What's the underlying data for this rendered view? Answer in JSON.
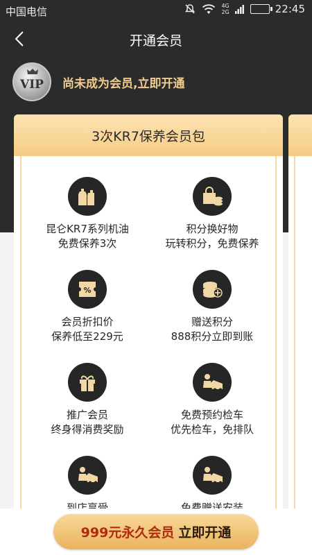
{
  "status_bar": {
    "carrier": "中国电信",
    "network": "4G\n2G",
    "time": "22:45"
  },
  "nav": {
    "title": "开通会员"
  },
  "vip": {
    "badge_text": "VIP",
    "status_text": "尚未成为会员,立即开通"
  },
  "package": {
    "title": "3次KR7保养会员包",
    "benefits": [
      {
        "title": "昆仑KR7系列机油",
        "desc": "免费保养3次",
        "icon": "oil-bottles-icon"
      },
      {
        "title": "积分换好物",
        "desc": "玩转积分，免费保养",
        "icon": "shopping-bag-coins-icon"
      },
      {
        "title": "会员折扣价",
        "desc": "保养低至229元",
        "icon": "discount-ticket-icon"
      },
      {
        "title": "赠送积分",
        "desc": "888积分立即到账",
        "icon": "coins-stack-icon"
      },
      {
        "title": "推广会员",
        "desc": "终身得消费奖励",
        "icon": "gift-box-icon"
      },
      {
        "title": "免费预约检车",
        "desc": "优先检车，免排队",
        "icon": "mechanic-car-icon"
      },
      {
        "title": "到店享受",
        "desc": "",
        "icon": "mechanic-car-icon"
      },
      {
        "title": "免费赠送安装",
        "desc": "",
        "icon": "mechanic-car-icon"
      }
    ]
  },
  "cta": {
    "price": "999元永久会员",
    "action": "立即开通"
  },
  "colors": {
    "dark_bg": "#2b2b2b",
    "gold_text": "#f0cd8f",
    "cta_gold": "#f2c679",
    "price_red": "#b12a10"
  }
}
